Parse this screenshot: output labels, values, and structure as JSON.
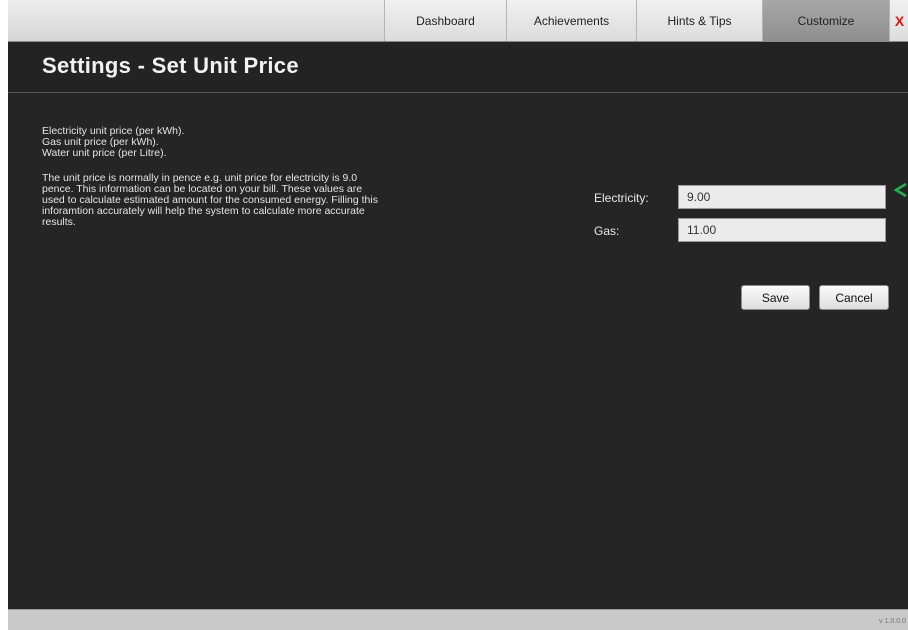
{
  "nav": {
    "tabs": [
      {
        "label": "Dashboard"
      },
      {
        "label": "Achievements"
      },
      {
        "label": "Hints & Tips"
      },
      {
        "label": "Customize",
        "active": true
      }
    ],
    "close_label": "X"
  },
  "page": {
    "title": "Settings - Set Unit Price"
  },
  "description": {
    "lines": [
      "Electricity unit price (per kWh).",
      "Gas unit price (per kWh).",
      "Water unit price (per Litre)."
    ],
    "paragraph": [
      "The unit price is normally in pence e.g. unit price for electricity is 9.0",
      "pence. This information can be located on your bill. These values are",
      "used to calculate estimated amount for the consumed energy. Filling this",
      "inforamtion accurately will help the system to calculate more accurate",
      "results."
    ]
  },
  "form": {
    "electricity": {
      "label": "Electricity:",
      "value": "9.00"
    },
    "gas": {
      "label": "Gas:",
      "value": "11.00"
    },
    "save_label": "Save",
    "cancel_label": "Cancel"
  },
  "indicator": {
    "icon": "green-arrow-left-icon",
    "color": "#1fb34a"
  },
  "footer": {
    "version": "v 1.0.0.0"
  }
}
